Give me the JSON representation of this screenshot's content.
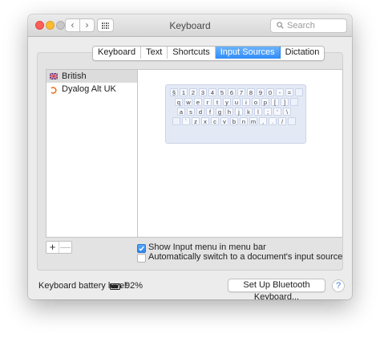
{
  "window": {
    "title": "Keyboard",
    "nav": {
      "back": "‹",
      "forward": "›"
    },
    "search": {
      "placeholder": "Search"
    }
  },
  "tabs": [
    {
      "label": "Keyboard",
      "active": false
    },
    {
      "label": "Text",
      "active": false
    },
    {
      "label": "Shortcuts",
      "active": false
    },
    {
      "label": "Input Sources",
      "active": true
    },
    {
      "label": "Dictation",
      "active": false
    }
  ],
  "input_sources": [
    {
      "label": "British",
      "icon": "uk-flag-icon",
      "selected": true
    },
    {
      "label": "Dyalog Alt UK",
      "icon": "dyalog-icon",
      "selected": false
    }
  ],
  "keyboard_rows": [
    [
      "§",
      "1",
      "2",
      "3",
      "4",
      "5",
      "6",
      "7",
      "8",
      "9",
      "0",
      "-",
      "="
    ],
    [
      "q",
      "w",
      "e",
      "r",
      "t",
      "y",
      "u",
      "i",
      "o",
      "p",
      "[",
      "]"
    ],
    [
      "a",
      "s",
      "d",
      "f",
      "g",
      "h",
      "j",
      "k",
      "l",
      ";",
      "'",
      "\\"
    ],
    [
      "`",
      "z",
      "x",
      "c",
      "v",
      "b",
      "n",
      "m",
      ",",
      ".",
      "/",
      ""
    ]
  ],
  "list_controls": {
    "add": "+",
    "remove": "—"
  },
  "options": {
    "show_input_menu": {
      "label": "Show Input menu in menu bar",
      "checked": true
    },
    "auto_switch": {
      "label": "Automatically switch to a document's input source",
      "checked": false
    }
  },
  "footer": {
    "battery_label": "Keyboard battery level:",
    "battery_value": "92%",
    "battery_fraction": 0.92,
    "bluetooth_button": "Set Up Bluetooth Keyboard...",
    "help": "?"
  },
  "colors": {
    "accent": "#2f8cf7",
    "close": "#fc5f57",
    "minimize": "#fdbc2e"
  }
}
